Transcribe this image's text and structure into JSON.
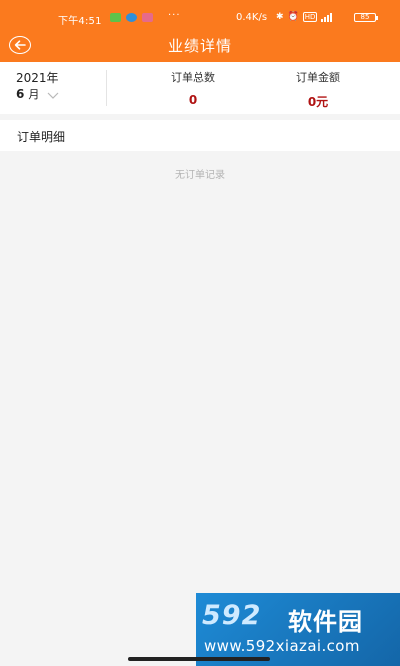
{
  "status_bar": {
    "time": "下午4:51",
    "more": "···",
    "net_speed": "0.4K/s",
    "hd_badge": "HD",
    "battery": "85",
    "icons": [
      "wechat-icon",
      "browser-icon",
      "mail-icon",
      "bluetooth-icon",
      "alarm-icon",
      "signal-icon"
    ]
  },
  "header": {
    "title": "业绩详情",
    "back_icon": "arrow-left-circle-icon",
    "color": "#fb7a1e"
  },
  "summary": {
    "year": "2021年",
    "month": "6",
    "month_unit": "月",
    "order_count_label": "订单总数",
    "order_count_value": "0",
    "order_amount_label": "订单金额",
    "order_amount_value": "0",
    "order_amount_unit": "元",
    "value_color": "#b01212"
  },
  "details": {
    "section_title": "订单明细",
    "empty_text": "无订单记录"
  },
  "watermark": {
    "logo": "592",
    "name": "软件园",
    "url": "www.592xiazai.com"
  }
}
